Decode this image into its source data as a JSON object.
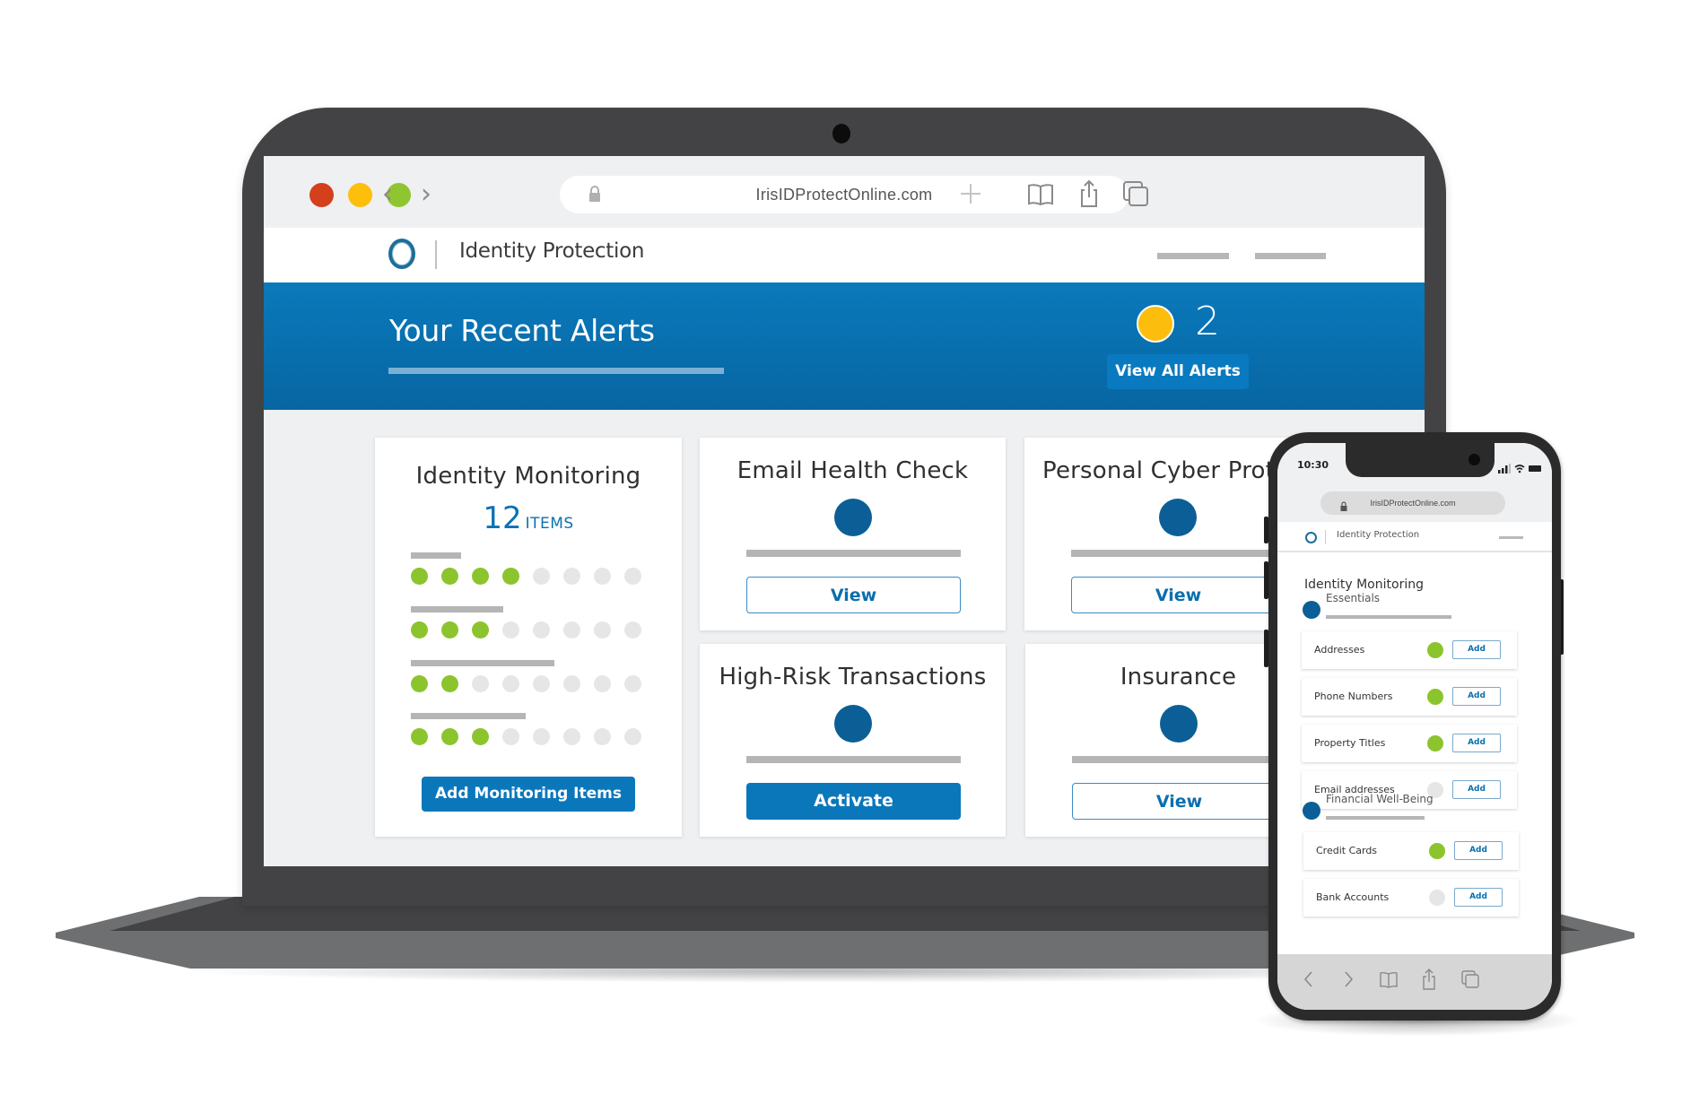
{
  "browser": {
    "url": "IrisIDProtectOnline.com",
    "icons": [
      "back-icon",
      "forward-icon",
      "lock-icon",
      "new-tab-icon",
      "bookmarks-icon",
      "share-icon",
      "tabs-icon"
    ],
    "back_glyph": "‹",
    "forward_glyph": "›"
  },
  "site": {
    "title": "Identity Protection"
  },
  "alerts": {
    "title": "Your Recent Alerts",
    "count": "2",
    "indicator_color": "#fdbd0c",
    "button_label": "View All Alerts"
  },
  "cards": {
    "identity_monitoring": {
      "title": "Identity Monitoring",
      "count": "12",
      "count_label": "ITEMS",
      "rows": [
        {
          "filled": 4,
          "total": 8
        },
        {
          "filled": 3,
          "total": 8
        },
        {
          "filled": 2,
          "total": 8
        },
        {
          "filled": 3,
          "total": 8
        }
      ],
      "button_label": "Add Monitoring Items"
    },
    "email_health": {
      "title": "Email Health Check",
      "button_label": "View"
    },
    "personal_cyber": {
      "title": "Personal Cyber Protection",
      "button_label": "View"
    },
    "high_risk": {
      "title": "High-Risk Transactions",
      "button_label": "Activate"
    },
    "insurance": {
      "title": "Insurance",
      "button_label": "View"
    }
  },
  "phone": {
    "time": "10:30",
    "url": "IrisIDProtectOnline.com",
    "site_title": "Identity Protection",
    "page_title": "Identity Monitoring",
    "sections": [
      {
        "title": "Essentials",
        "items": [
          {
            "label": "Addresses",
            "active": true,
            "button": "Add"
          },
          {
            "label": "Phone Numbers",
            "active": true,
            "button": "Add"
          },
          {
            "label": "Property Titles",
            "active": true,
            "button": "Add"
          },
          {
            "label": "Email addresses",
            "active": false,
            "button": "Add"
          }
        ]
      },
      {
        "title": "Financial Well-Being",
        "items": [
          {
            "label": "Credit Cards",
            "active": true,
            "button": "Add"
          },
          {
            "label": "Bank Accounts",
            "active": false,
            "button": "Add"
          }
        ]
      }
    ]
  },
  "colors": {
    "brand_blue": "#0b77bb",
    "dark_blue": "#0b5f96",
    "active_green": "#8cc42e",
    "inactive_gray": "#e6e6e6",
    "alert_yellow": "#fdbd0c"
  }
}
